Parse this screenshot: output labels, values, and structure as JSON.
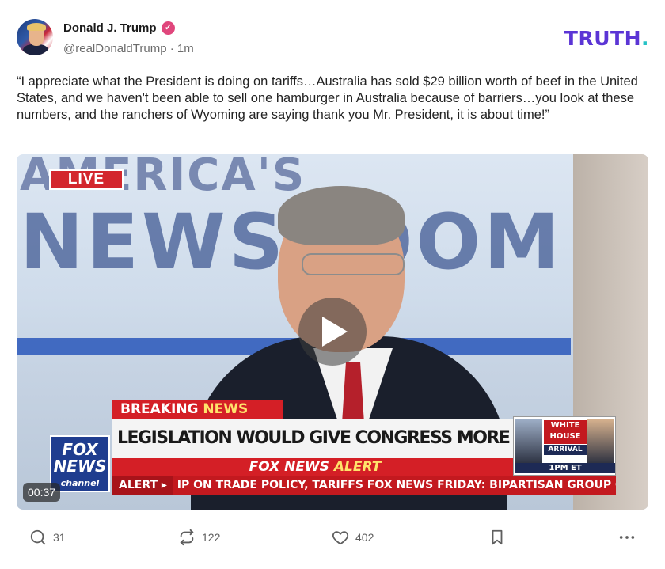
{
  "author": {
    "name": "Donald J. Trump",
    "handle": "@realDonaldTrump",
    "separator": "·",
    "time": "1m",
    "verified_icon": "verified-badge-icon"
  },
  "brand": {
    "logo_text": "TRUTH",
    "logo_dot": "."
  },
  "post": {
    "text": "“I appreciate what the President is doing on tariffs…Australia has sold $29 billion worth of beef in the United States, and we haven't been able to sell one hamburger in Australia because of barriers…you look at these numbers, and the ranchers of Wyoming are saying thank you Mr. President, it is about time!”"
  },
  "video": {
    "duration": "00:37",
    "backdrop_line1": "AMERICA'S",
    "backdrop_line2": "NEWSROOM",
    "live_badge": "LIVE",
    "breaking_word": "BREAKING",
    "breaking_news": "NEWS",
    "headline": "LEGISLATION WOULD GIVE CONGRESS MORE TARIFF POWER",
    "alert_fox": "FOX NEWS",
    "alert_word": "ALERT",
    "ticker_label": "ALERT ▸",
    "ticker_text": "IP ON TRADE POLICY, TARIFFS   FOX NEWS  FRIDAY: BIPARTISAN GROUP OF SEN",
    "fox_logo_line1": "FOX",
    "fox_logo_line2": "NEWS",
    "fox_logo_line3": "channel",
    "wh_label": "WHITE HOUSE",
    "wh_arrival": "ARRIVAL",
    "wh_time": "1PM ET"
  },
  "actions": {
    "replies": "31",
    "retruths": "122",
    "likes": "402"
  },
  "colors": {
    "brand": "#5b35d5",
    "brand_dot": "#25c2c6",
    "verified": "#e0467c",
    "fox_red": "#d41f26"
  }
}
